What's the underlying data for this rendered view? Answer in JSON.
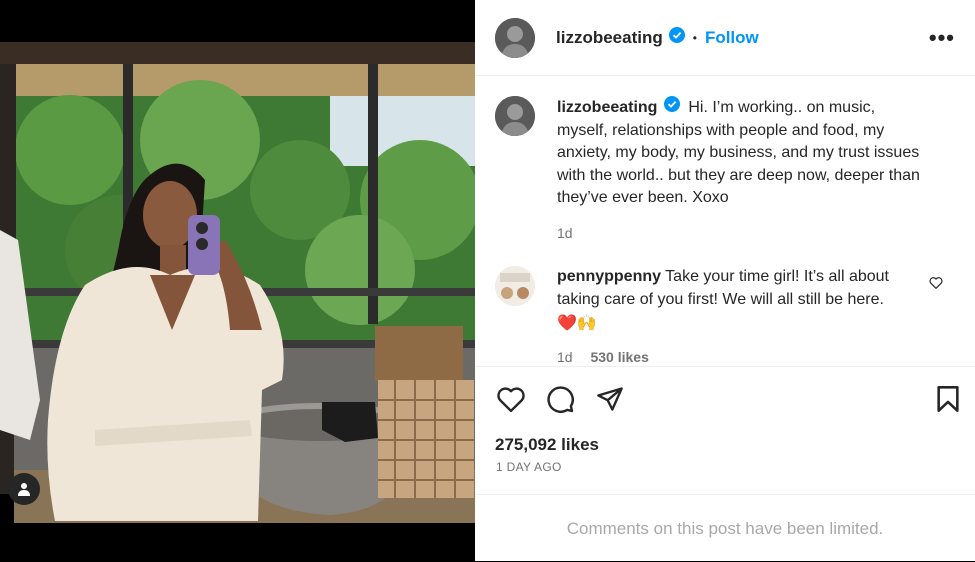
{
  "post": {
    "username": "lizzobeeating",
    "follow_label": "Follow",
    "separator": "•",
    "more_label": "•••"
  },
  "caption": {
    "username": "lizzobeeating",
    "text": "Hi. I’m working.. on music, myself, relationships with people and food, my anxiety, my body, my business, and my trust issues with the world.. but they are deep now, deeper than they’ve ever been. Xoxo",
    "time": "1d"
  },
  "comment": {
    "username": "pennyppenny",
    "text": "Take your time girl! It’s all about taking care of you first! We will all still be here.",
    "emojis": "❤️🙌",
    "time": "1d",
    "likes": "530 likes"
  },
  "stats": {
    "likes": "275,092 likes",
    "posted": "1 DAY AGO"
  },
  "footer": {
    "limited": "Comments on this post have been limited."
  },
  "icons": {
    "tag": "person-tag-icon",
    "verified": "verified-badge-icon",
    "like": "heart-icon",
    "comment": "comment-icon",
    "share": "send-icon",
    "save": "bookmark-icon"
  },
  "colors": {
    "link": "#0095f6",
    "verified": "#0095f6",
    "text": "#262626",
    "muted": "#737373",
    "limited": "#a8a8a8"
  }
}
